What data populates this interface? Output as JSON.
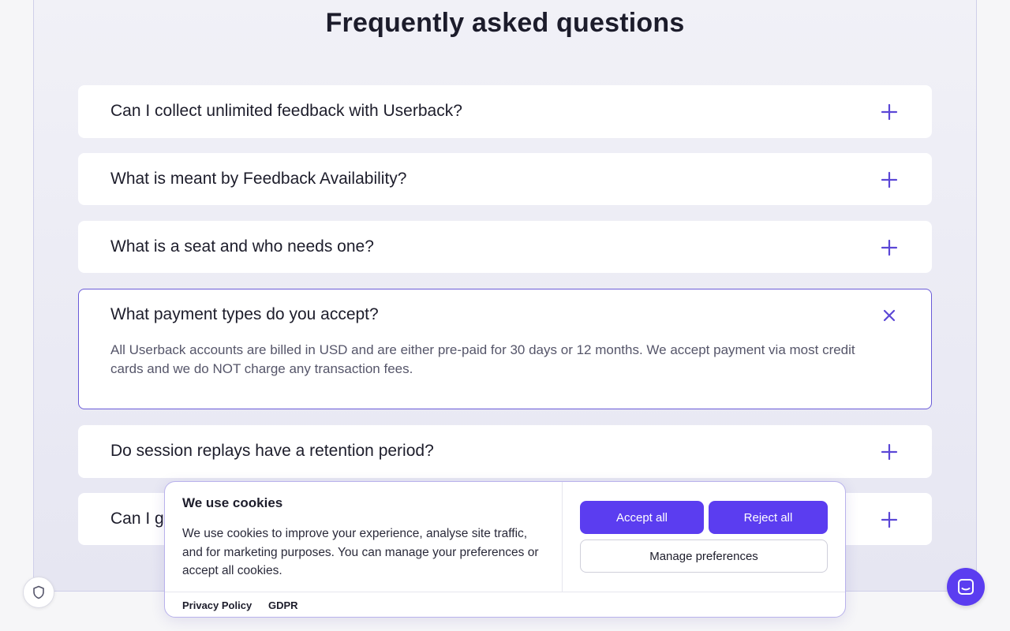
{
  "faq": {
    "title": "Frequently asked questions",
    "items": [
      {
        "question": "Can I collect unlimited feedback with Userback?",
        "expanded": false
      },
      {
        "question": "What is meant by Feedback Availability?",
        "expanded": false
      },
      {
        "question": "What is a seat and who needs one?",
        "expanded": false
      },
      {
        "question": "What payment types do you accept?",
        "expanded": true,
        "answer": "All Userback accounts are billed in USD and are either pre-paid for 30 days or 12 months. We accept payment via most credit cards and we do NOT charge any transaction fees."
      },
      {
        "question": "Do session replays have a retention period?",
        "expanded": false
      },
      {
        "question": "Can I g",
        "expanded": false
      }
    ]
  },
  "cookie_banner": {
    "title": "We use cookies",
    "text": "We use cookies to improve your experience, analyse site traffic, and for marketing purposes. You can manage your preferences or accept all cookies.",
    "accept_label": "Accept all",
    "reject_label": "Reject all",
    "manage_label": "Manage preferences",
    "links": [
      "Privacy Policy",
      "GDPR"
    ]
  },
  "icons": {
    "expand": "plus-icon",
    "collapse": "close-icon",
    "privacy": "shield-icon",
    "chat": "chat-icon"
  },
  "colors": {
    "accent": "#5b3df0",
    "icon": "#5b47d6",
    "open_border": "#6a5bd8"
  }
}
